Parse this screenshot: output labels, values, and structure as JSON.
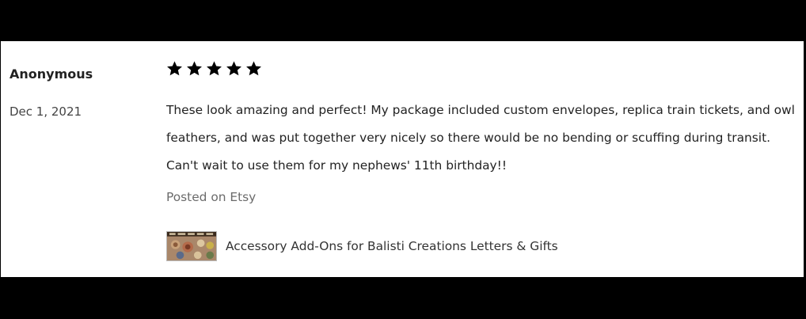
{
  "review": {
    "reviewer_name": "Anonymous",
    "date": "Dec 1, 2021",
    "rating": 5,
    "rating_max": 5,
    "star_color": "#000000",
    "text": "These look amazing and perfect! My package included custom envelopes, replica train tickets, and owl feathers, and was put together very nicely so there would be no bending or scuffing during transit. Can't wait to use them for my nephews' 11th birthday!!",
    "posted_on": "Posted on Etsy"
  },
  "product": {
    "name": "Accessory Add-Ons for Balisti Creations Letters & Gifts",
    "thumbnail_icon": "product-thumbnail-image"
  }
}
